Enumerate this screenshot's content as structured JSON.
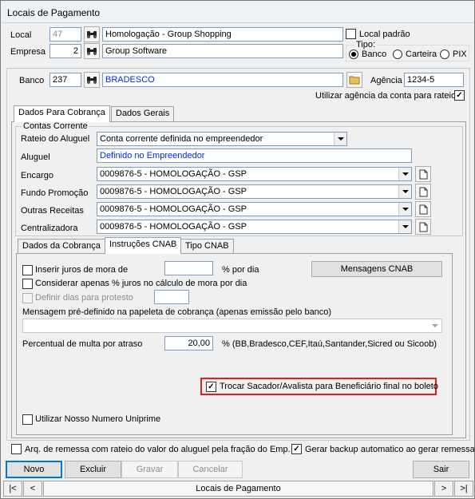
{
  "window": {
    "title": "Locais de Pagamento"
  },
  "header": {
    "local_label": "Local",
    "local_code": "47",
    "local_name": "Homologação - Group Shopping",
    "local_padrao_label": "Local padrão",
    "local_padrao_checked": false,
    "empresa_label": "Empresa",
    "empresa_code": "2",
    "empresa_name": "Group Software",
    "tipo_label": "Tipo:",
    "tipo_options": [
      "Banco",
      "Carteira",
      "PIX"
    ],
    "tipo_selected": "Banco"
  },
  "banco": {
    "label": "Banco",
    "code": "237",
    "name": "BRADESCO",
    "agencia_label": "Agência",
    "agencia_value": "1234-5",
    "usar_agencia_label": "Utilizar agência da conta para rateio",
    "usar_agencia_checked": true
  },
  "outer_tabs": [
    "Dados Para Cobrança",
    "Dados Gerais"
  ],
  "contas": {
    "group_label": "Contas Corrente",
    "rateio_label": "Rateio do Aluguel",
    "rateio_value": "Conta corrente definida no empreendedor",
    "aluguel_label": "Aluguel",
    "aluguel_value": "Definido no Empreendedor",
    "encargo_label": "Encargo",
    "encargo_value": "0009876-5 - HOMOLOGAÇÃO - GSP",
    "fundo_label": "Fundo Promoção",
    "fundo_value": "0009876-5 - HOMOLOGAÇÃO - GSP",
    "outras_label": "Outras Receitas",
    "outras_value": "0009876-5 - HOMOLOGAÇÃO - GSP",
    "central_label": "Centralizadora",
    "central_value": "0009876-5 - HOMOLOGAÇÃO - GSP"
  },
  "inner_tabs": [
    "Dados da Cobrança",
    "Instruções CNAB",
    "Tipo CNAB"
  ],
  "cnab": {
    "juros_label": "Inserir juros de mora de",
    "juros_value": "",
    "por_dia_label": "% por dia",
    "mensagens_button": "Mensagens CNAB",
    "considerar_label": "Considerar apenas % juros no cálculo de mora por dia",
    "definir_dias_label": "Definir dias para protesto",
    "definir_dias_value": "",
    "mensagem_label": "Mensagem pré-definido na papeleta de cobrança (apenas emissão pelo banco)",
    "mensagem_value": "",
    "multa_label": "Percentual de multa por atraso",
    "multa_value": "20,00",
    "multa_suffix": "% (BB,Bradesco,CEF,Itaú,Santander,Sicred ou Sicoob)",
    "trocar_label": "Trocar Sacador/Avalista para Beneficiário final no boleto",
    "trocar_checked": true,
    "nosso_numero_label": "Utilizar Nosso Numero Uniprime",
    "nosso_numero_checked": false
  },
  "footer": {
    "arq_remessa_label": "Arq. de remessa com rateio do valor do aluguel pela fração do Emp.",
    "arq_remessa_checked": false,
    "backup_label": "Gerar backup automatico ao gerar remessa",
    "backup_checked": true
  },
  "buttons": {
    "novo": "Novo",
    "excluir": "Excluir",
    "gravar": "Gravar",
    "cancelar": "Cancelar",
    "sair": "Sair"
  },
  "navigator": {
    "first": "|<",
    "prev": "<",
    "caption": "Locais de Pagamento",
    "next": ">",
    "last": ">|"
  },
  "colors": {
    "highlight_border": "#e02020",
    "link_blue": "#0026ff"
  }
}
